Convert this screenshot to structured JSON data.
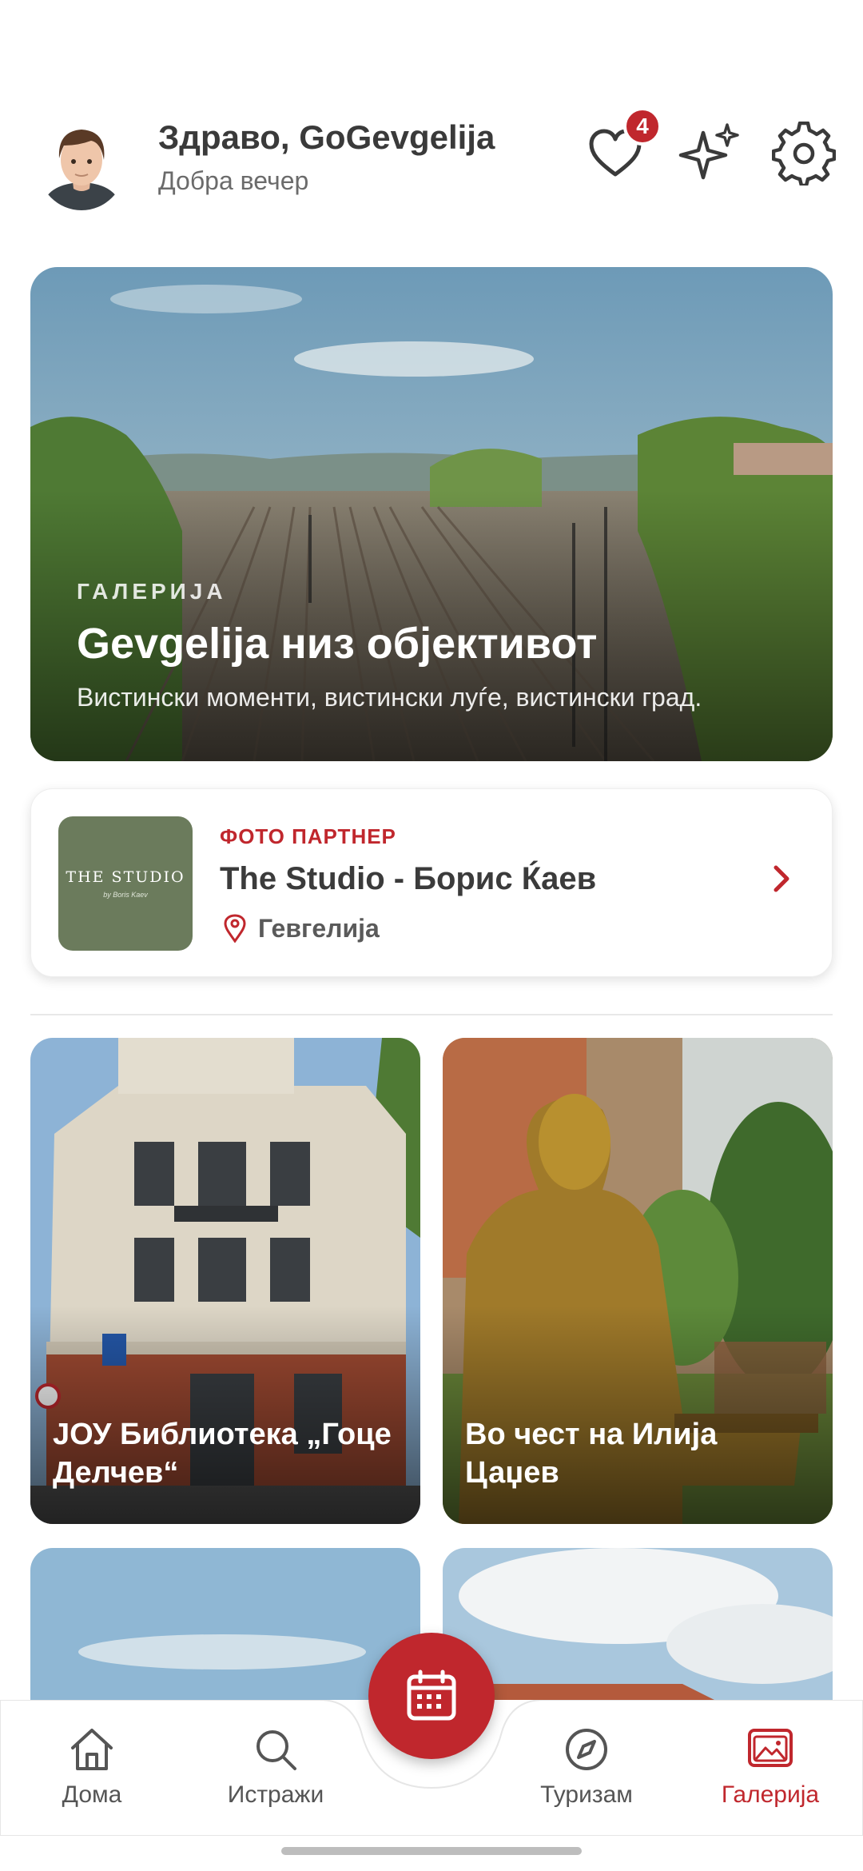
{
  "header": {
    "greeting": "Здраво, GoGevgelija",
    "subtitle": "Добра вечер",
    "favorites_count": "4",
    "icons": [
      "heart-icon",
      "sparkles-icon",
      "gear-icon"
    ]
  },
  "hero": {
    "kicker": "ГАЛЕРИЈА",
    "title": "Gevgelija низ објективот",
    "subtitle": "Вистински моменти, вистински луѓе, вистински град."
  },
  "partner": {
    "kicker": "ФОТО ПАРТНЕР",
    "name": "The Studio - Борис Ќаев",
    "location": "Гевгелија",
    "logo_line1": "THE STUDIO",
    "logo_line2": "by Boris Kaev"
  },
  "gallery": [
    {
      "title": "ЈОУ Библиотека „Гоце Делчев“"
    },
    {
      "title": "Во чест на Илија Цаџев"
    },
    {
      "title": ""
    },
    {
      "title": ""
    }
  ],
  "nav": {
    "items": [
      {
        "label": "Дома",
        "icon": "home-icon"
      },
      {
        "label": "Истражи",
        "icon": "search-icon"
      },
      {
        "label": "Туризам",
        "icon": "compass-icon"
      },
      {
        "label": "Галерија",
        "icon": "gallery-icon"
      }
    ],
    "fab_icon": "calendar-icon",
    "active": "Галерија"
  },
  "colors": {
    "accent": "#c0272d",
    "text": "#3a3a3a",
    "muted": "#6b6b6b"
  }
}
